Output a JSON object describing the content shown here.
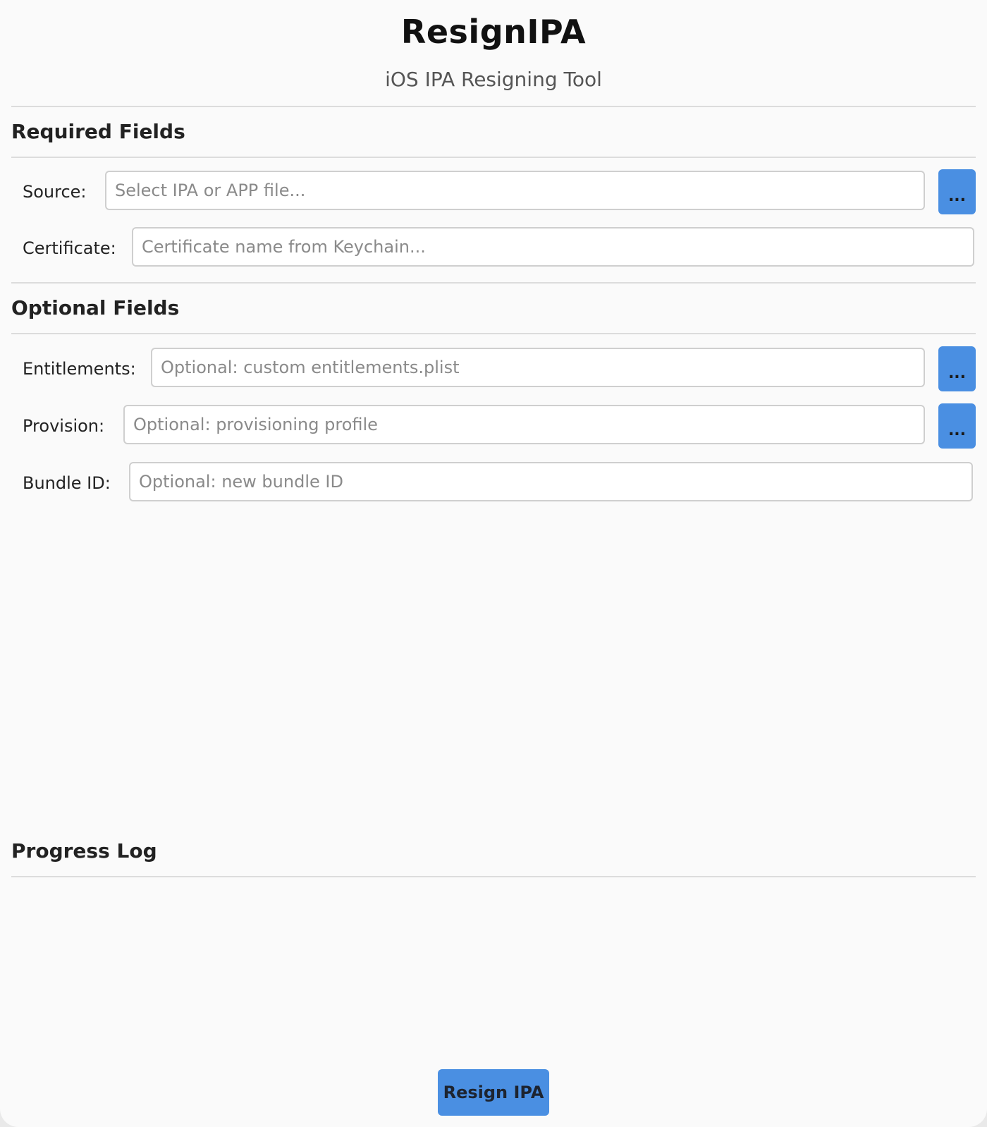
{
  "app": {
    "title": "ResignIPA",
    "subtitle": "iOS IPA Resigning Tool"
  },
  "required": {
    "section_title": "Required Fields",
    "source": {
      "label": "Source:",
      "value": "",
      "placeholder": "Select IPA or APP file...",
      "browse_label": "..."
    },
    "certificate": {
      "label": "Certificate:",
      "value": "",
      "placeholder": "Certificate name from Keychain..."
    }
  },
  "optional": {
    "section_title": "Optional Fields",
    "entitlements": {
      "label": "Entitlements:",
      "value": "",
      "placeholder": "Optional: custom entitlements.plist",
      "browse_label": "..."
    },
    "provision": {
      "label": "Provision:",
      "value": "",
      "placeholder": "Optional: provisioning profile",
      "browse_label": "..."
    },
    "bundle_id": {
      "label": "Bundle ID:",
      "value": "",
      "placeholder": "Optional: new bundle ID"
    }
  },
  "progress": {
    "section_title": "Progress Log",
    "log_text": ""
  },
  "actions": {
    "resign_label": "Resign IPA"
  },
  "colors": {
    "accent": "#4a8fe2",
    "background": "#fafafa",
    "divider": "#dcdcdc"
  }
}
